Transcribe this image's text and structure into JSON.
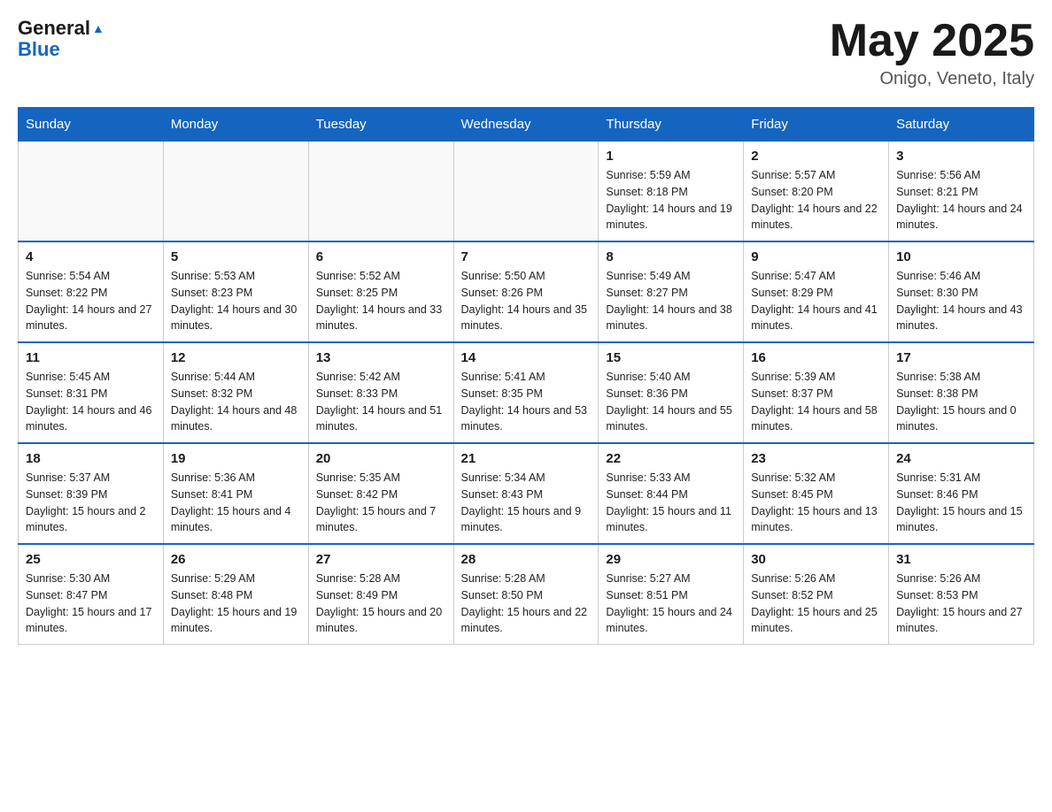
{
  "header": {
    "logo_line1": "General",
    "logo_line2": "Blue",
    "month_year": "May 2025",
    "location": "Onigo, Veneto, Italy"
  },
  "days_of_week": [
    "Sunday",
    "Monday",
    "Tuesday",
    "Wednesday",
    "Thursday",
    "Friday",
    "Saturday"
  ],
  "weeks": [
    [
      {
        "day": "",
        "info": ""
      },
      {
        "day": "",
        "info": ""
      },
      {
        "day": "",
        "info": ""
      },
      {
        "day": "",
        "info": ""
      },
      {
        "day": "1",
        "info": "Sunrise: 5:59 AM\nSunset: 8:18 PM\nDaylight: 14 hours and 19 minutes."
      },
      {
        "day": "2",
        "info": "Sunrise: 5:57 AM\nSunset: 8:20 PM\nDaylight: 14 hours and 22 minutes."
      },
      {
        "day": "3",
        "info": "Sunrise: 5:56 AM\nSunset: 8:21 PM\nDaylight: 14 hours and 24 minutes."
      }
    ],
    [
      {
        "day": "4",
        "info": "Sunrise: 5:54 AM\nSunset: 8:22 PM\nDaylight: 14 hours and 27 minutes."
      },
      {
        "day": "5",
        "info": "Sunrise: 5:53 AM\nSunset: 8:23 PM\nDaylight: 14 hours and 30 minutes."
      },
      {
        "day": "6",
        "info": "Sunrise: 5:52 AM\nSunset: 8:25 PM\nDaylight: 14 hours and 33 minutes."
      },
      {
        "day": "7",
        "info": "Sunrise: 5:50 AM\nSunset: 8:26 PM\nDaylight: 14 hours and 35 minutes."
      },
      {
        "day": "8",
        "info": "Sunrise: 5:49 AM\nSunset: 8:27 PM\nDaylight: 14 hours and 38 minutes."
      },
      {
        "day": "9",
        "info": "Sunrise: 5:47 AM\nSunset: 8:29 PM\nDaylight: 14 hours and 41 minutes."
      },
      {
        "day": "10",
        "info": "Sunrise: 5:46 AM\nSunset: 8:30 PM\nDaylight: 14 hours and 43 minutes."
      }
    ],
    [
      {
        "day": "11",
        "info": "Sunrise: 5:45 AM\nSunset: 8:31 PM\nDaylight: 14 hours and 46 minutes."
      },
      {
        "day": "12",
        "info": "Sunrise: 5:44 AM\nSunset: 8:32 PM\nDaylight: 14 hours and 48 minutes."
      },
      {
        "day": "13",
        "info": "Sunrise: 5:42 AM\nSunset: 8:33 PM\nDaylight: 14 hours and 51 minutes."
      },
      {
        "day": "14",
        "info": "Sunrise: 5:41 AM\nSunset: 8:35 PM\nDaylight: 14 hours and 53 minutes."
      },
      {
        "day": "15",
        "info": "Sunrise: 5:40 AM\nSunset: 8:36 PM\nDaylight: 14 hours and 55 minutes."
      },
      {
        "day": "16",
        "info": "Sunrise: 5:39 AM\nSunset: 8:37 PM\nDaylight: 14 hours and 58 minutes."
      },
      {
        "day": "17",
        "info": "Sunrise: 5:38 AM\nSunset: 8:38 PM\nDaylight: 15 hours and 0 minutes."
      }
    ],
    [
      {
        "day": "18",
        "info": "Sunrise: 5:37 AM\nSunset: 8:39 PM\nDaylight: 15 hours and 2 minutes."
      },
      {
        "day": "19",
        "info": "Sunrise: 5:36 AM\nSunset: 8:41 PM\nDaylight: 15 hours and 4 minutes."
      },
      {
        "day": "20",
        "info": "Sunrise: 5:35 AM\nSunset: 8:42 PM\nDaylight: 15 hours and 7 minutes."
      },
      {
        "day": "21",
        "info": "Sunrise: 5:34 AM\nSunset: 8:43 PM\nDaylight: 15 hours and 9 minutes."
      },
      {
        "day": "22",
        "info": "Sunrise: 5:33 AM\nSunset: 8:44 PM\nDaylight: 15 hours and 11 minutes."
      },
      {
        "day": "23",
        "info": "Sunrise: 5:32 AM\nSunset: 8:45 PM\nDaylight: 15 hours and 13 minutes."
      },
      {
        "day": "24",
        "info": "Sunrise: 5:31 AM\nSunset: 8:46 PM\nDaylight: 15 hours and 15 minutes."
      }
    ],
    [
      {
        "day": "25",
        "info": "Sunrise: 5:30 AM\nSunset: 8:47 PM\nDaylight: 15 hours and 17 minutes."
      },
      {
        "day": "26",
        "info": "Sunrise: 5:29 AM\nSunset: 8:48 PM\nDaylight: 15 hours and 19 minutes."
      },
      {
        "day": "27",
        "info": "Sunrise: 5:28 AM\nSunset: 8:49 PM\nDaylight: 15 hours and 20 minutes."
      },
      {
        "day": "28",
        "info": "Sunrise: 5:28 AM\nSunset: 8:50 PM\nDaylight: 15 hours and 22 minutes."
      },
      {
        "day": "29",
        "info": "Sunrise: 5:27 AM\nSunset: 8:51 PM\nDaylight: 15 hours and 24 minutes."
      },
      {
        "day": "30",
        "info": "Sunrise: 5:26 AM\nSunset: 8:52 PM\nDaylight: 15 hours and 25 minutes."
      },
      {
        "day": "31",
        "info": "Sunrise: 5:26 AM\nSunset: 8:53 PM\nDaylight: 15 hours and 27 minutes."
      }
    ]
  ]
}
